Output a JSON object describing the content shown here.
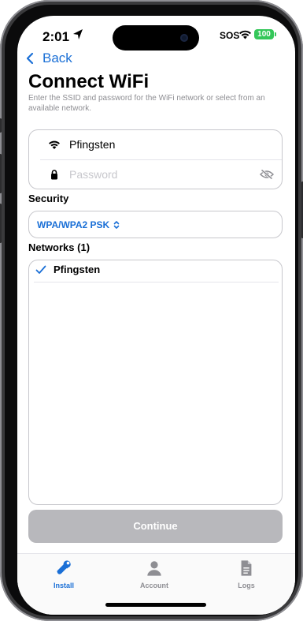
{
  "status_bar": {
    "time": "2:01",
    "sos": "SOS",
    "battery": "100"
  },
  "nav": {
    "back_label": "Back"
  },
  "page": {
    "title": "Connect WiFi",
    "subtitle": "Enter the SSID and password for the WiFi network or select from an available network."
  },
  "credentials": {
    "ssid_value": "Pfingsten",
    "password_placeholder": "Password"
  },
  "security": {
    "label": "Security",
    "selected": "WPA/WPA2 PSK"
  },
  "networks": {
    "label": "Networks (1)",
    "items": [
      {
        "name": "Pfingsten",
        "selected": true
      }
    ]
  },
  "continue_label": "Continue",
  "tabs": [
    {
      "label": "Install",
      "icon": "wrench-icon",
      "active": true
    },
    {
      "label": "Account",
      "icon": "person-icon",
      "active": false
    },
    {
      "label": "Logs",
      "icon": "document-icon",
      "active": false
    }
  ],
  "colors": {
    "accent": "#1a6fd6",
    "battery": "#34c759",
    "disabled_button": "#b8b8bc",
    "inactive_tab": "#8e8e93"
  }
}
